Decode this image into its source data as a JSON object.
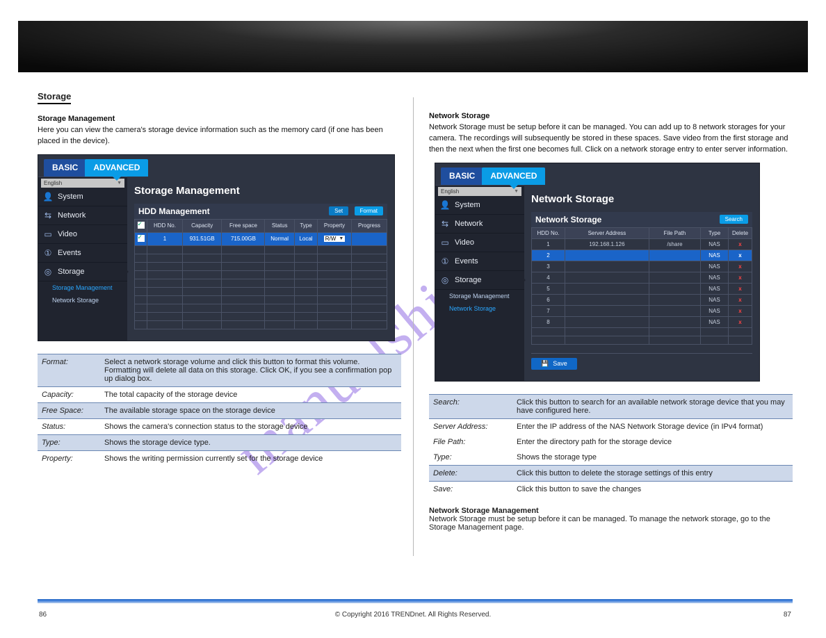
{
  "watermark": "manualshive.com",
  "page_left": "86",
  "page_right": "87",
  "copyright": "© Copyright 2016 TRENDnet. All Rights Reserved.",
  "hero": {},
  "left": {
    "sec_heading": "Storage",
    "intro1": "Storage Management",
    "intro2": "Here you can view the camera's storage device information such as the memory card (if one has been placed in the device).",
    "shot": {
      "tabs": {
        "basic": "BASIC",
        "advanced": "ADVANCED"
      },
      "lang": "English",
      "sidebar": {
        "items": [
          {
            "icon": "user-icon",
            "label": "System"
          },
          {
            "icon": "network-icon",
            "label": "Network"
          },
          {
            "icon": "camera-icon",
            "label": "Video"
          },
          {
            "icon": "alert-icon",
            "label": "Events"
          },
          {
            "icon": "disk-icon",
            "label": "Storage"
          }
        ],
        "subs": [
          {
            "label": "Storage Management",
            "active": true
          },
          {
            "label": "Network Storage",
            "active": false
          }
        ]
      },
      "main_title": "Storage Management",
      "panel_title": "HDD Management",
      "buttons": {
        "set": "Set",
        "format": "Format"
      },
      "headers": [
        "",
        "HDD No.",
        "Capacity",
        "Free space",
        "Status",
        "Type",
        "Property",
        "Progress"
      ],
      "row": {
        "no": "1",
        "capacity": "931.51GB",
        "free": "715.00GB",
        "status": "Normal",
        "type": "Local",
        "property": "R/W",
        "progress": ""
      }
    },
    "desc": [
      {
        "k": "Format:",
        "v": "Select a network storage volume and click this button to format this volume. Formatting will delete all data on this storage. Click OK, if you see a confirmation pop up dialog box.",
        "hdr": true
      },
      {
        "k": "Capacity:",
        "v": "The total capacity of the storage device"
      },
      {
        "k": "Free Space:",
        "v": "The available storage space on the storage device",
        "hdr": true
      },
      {
        "k": "Status:",
        "v": "Shows the camera's connection status to the storage device"
      },
      {
        "k": "Type:",
        "v": "Shows the storage device type.",
        "hdr": true
      },
      {
        "k": "Property:",
        "v": "Shows the writing permission currently set for the storage device"
      }
    ]
  },
  "right": {
    "intro_head": "Network Storage",
    "intro_body": "Network Storage must be setup before it can be managed. You can add up to 8 network storages for your camera. The recordings will subsequently be stored in these spaces. Save video from the first storage and then the next when the first one becomes full. Click on a network storage entry to enter server information.",
    "shot": {
      "tabs": {
        "basic": "BASIC",
        "advanced": "ADVANCED"
      },
      "lang": "English",
      "sidebar": {
        "items": [
          {
            "icon": "user-icon",
            "label": "System"
          },
          {
            "icon": "network-icon",
            "label": "Network"
          },
          {
            "icon": "camera-icon",
            "label": "Video"
          },
          {
            "icon": "alert-icon",
            "label": "Events"
          },
          {
            "icon": "disk-icon",
            "label": "Storage"
          }
        ],
        "subs": [
          {
            "label": "Storage Management",
            "active": false
          },
          {
            "label": "Network Storage",
            "active": true
          }
        ]
      },
      "main_title": "Network Storage",
      "panel_title": "Network Storage",
      "buttons": {
        "search": "Search",
        "save": "Save"
      },
      "headers": [
        "HDD No.",
        "Server Address",
        "File Path",
        "Type",
        "Delete"
      ],
      "rows": [
        {
          "no": "1",
          "addr": "192.168.1.126",
          "path": "/share",
          "type": "NAS",
          "del": "x"
        },
        {
          "no": "2",
          "addr": "",
          "path": "",
          "type": "NAS",
          "del": "x",
          "sel": true
        },
        {
          "no": "3",
          "addr": "",
          "path": "",
          "type": "NAS",
          "del": "x"
        },
        {
          "no": "4",
          "addr": "",
          "path": "",
          "type": "NAS",
          "del": "x"
        },
        {
          "no": "5",
          "addr": "",
          "path": "",
          "type": "NAS",
          "del": "x"
        },
        {
          "no": "6",
          "addr": "",
          "path": "",
          "type": "NAS",
          "del": "x"
        },
        {
          "no": "7",
          "addr": "",
          "path": "",
          "type": "NAS",
          "del": "x"
        },
        {
          "no": "8",
          "addr": "",
          "path": "",
          "type": "NAS",
          "del": "x"
        }
      ]
    },
    "desc": [
      {
        "k": "Search:",
        "v": "Click this button to search for an available network storage device that you may have configured here.",
        "hdr": true
      },
      {
        "k": "Server Address:",
        "v": "Enter the IP address of the NAS Network Storage device (in IPv4 format)"
      },
      {
        "k": "File Path:",
        "v": "Enter the directory path for the storage device"
      },
      {
        "k": "Type:",
        "v": "Shows the storage type"
      },
      {
        "k": "Delete:",
        "v": "Click this button to delete the storage settings of this entry",
        "hdr": true
      },
      {
        "k": "Save:",
        "v": "Click this button to save the changes"
      }
    ],
    "note_head": "Network Storage Management",
    "note_body": "Network Storage must be setup before it can be managed. To manage the network storage, go to the Storage Management page."
  }
}
